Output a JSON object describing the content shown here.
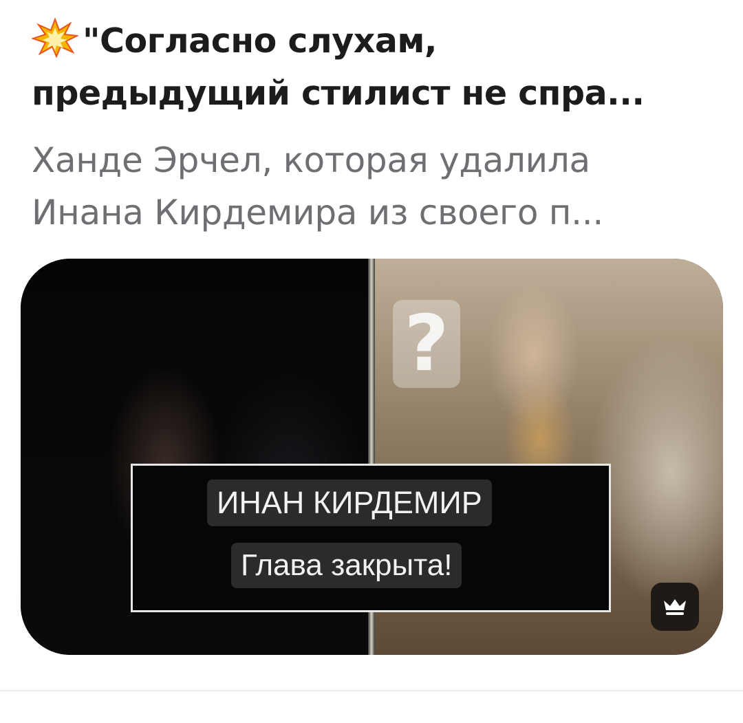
{
  "article": {
    "headline_line1": "\"Согласно слухам,",
    "headline_line2": "предыдущий стилист не спра...",
    "subtitle_line1": "Ханде Эрчел, которая удалила",
    "subtitle_line2": "Инана Кирдемира из своего п..."
  },
  "thumbnail": {
    "question_mark": "?",
    "caption_name": "ИНАН КИРДЕМИР",
    "caption_sub": "Глава закрыта!"
  },
  "icons": {
    "headline_emoji": "collision-icon",
    "badge": "crown-icon"
  },
  "colors": {
    "headline": "#1c1c1e",
    "subtitle": "#6e6e73",
    "badge_bg": "#1f1a16",
    "badge_icon": "#ffffff"
  }
}
